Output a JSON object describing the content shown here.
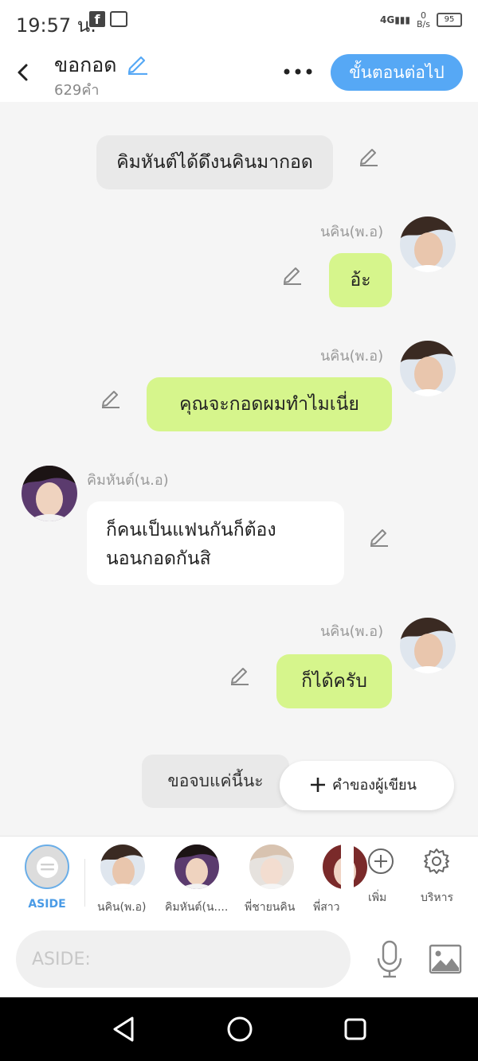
{
  "status_bar": {
    "time": "19:57 น.",
    "network": "4G",
    "data_speed": "0",
    "data_unit": "B/s",
    "battery": "95"
  },
  "header": {
    "title": "ขอกอด",
    "word_count": "629คำ",
    "next_button_label": "ขั้นตอนต่อไป"
  },
  "messages": [
    {
      "type": "narration",
      "text": "คิมหันต์ได้ดึงนคินมากอด"
    },
    {
      "type": "outgoing",
      "sender": "นคิน(พ.อ)",
      "text": "อ้ะ"
    },
    {
      "type": "outgoing",
      "sender": "นคิน(พ.อ)",
      "text": "คุณจะกอดผมทำไมเนี่ย"
    },
    {
      "type": "incoming",
      "sender": "คิมหันต์(น.อ)",
      "lines": [
        "ก็คนเป็นแฟนกันก็ต้อง",
        "นอนกอดกันสิ"
      ]
    },
    {
      "type": "outgoing",
      "sender": "นคิน(พ.อ)",
      "text": "ก็ได้ครับ"
    }
  ],
  "ending_chip": "ขอจบแค่นี้นะ",
  "writer_button_label": "คำของผู้เขียน",
  "characters": {
    "aside_label": "ASIDE",
    "items": [
      {
        "label": "นคิน(พ.อ)"
      },
      {
        "label": "คิมหันต์(น...."
      },
      {
        "label": "พี่ชายนคิน"
      },
      {
        "label": "พี่สาว"
      }
    ],
    "add_label": "เพิ่ม",
    "manage_label": "บริหาร"
  },
  "input": {
    "placeholder": "ASIDE:",
    "value": ""
  },
  "colors": {
    "accent": "#56a8f5",
    "outgoing_bubble": "#d6f58c",
    "incoming_bubble": "#ffffff",
    "narration_bubble": "#e9e9e9"
  }
}
